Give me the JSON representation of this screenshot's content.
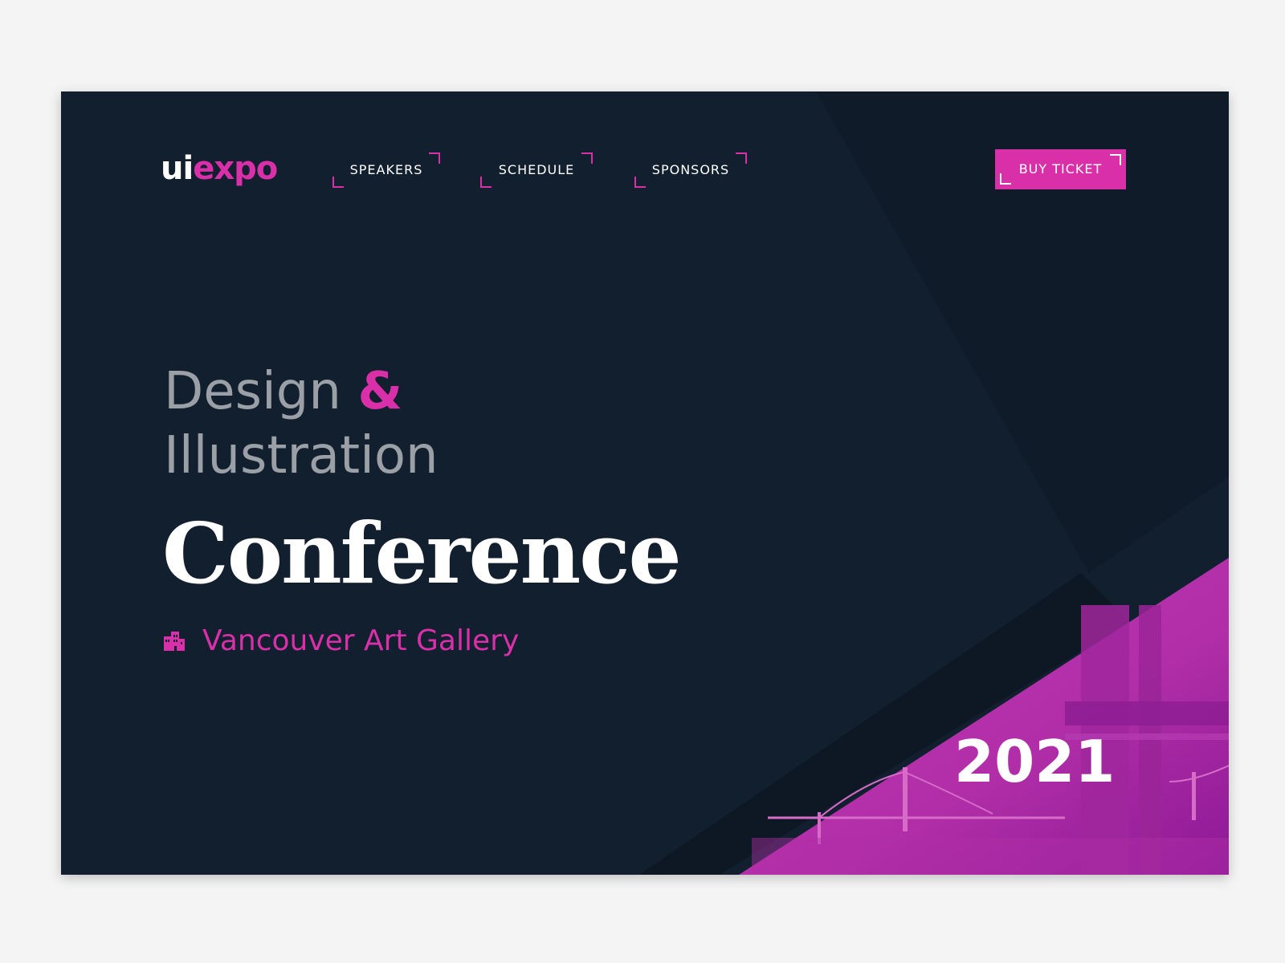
{
  "brand": {
    "logo_prefix": "ui",
    "logo_suffix": "expo"
  },
  "nav": {
    "items": [
      {
        "label": "SPEAKERS"
      },
      {
        "label": "SCHEDULE"
      },
      {
        "label": "SPONSORS"
      }
    ],
    "cta_label": "BUY TICKET"
  },
  "hero": {
    "line1_word": "Design",
    "line1_amp": "&",
    "line2": "Illustration",
    "headline": "Conference",
    "venue": "Vancouver Art Gallery",
    "venue_icon": "building-icon",
    "year": "2021"
  },
  "colors": {
    "background": "#121f2e",
    "accent": "#d92fa8",
    "muted_text": "#9aa0a6",
    "text": "#ffffff"
  }
}
